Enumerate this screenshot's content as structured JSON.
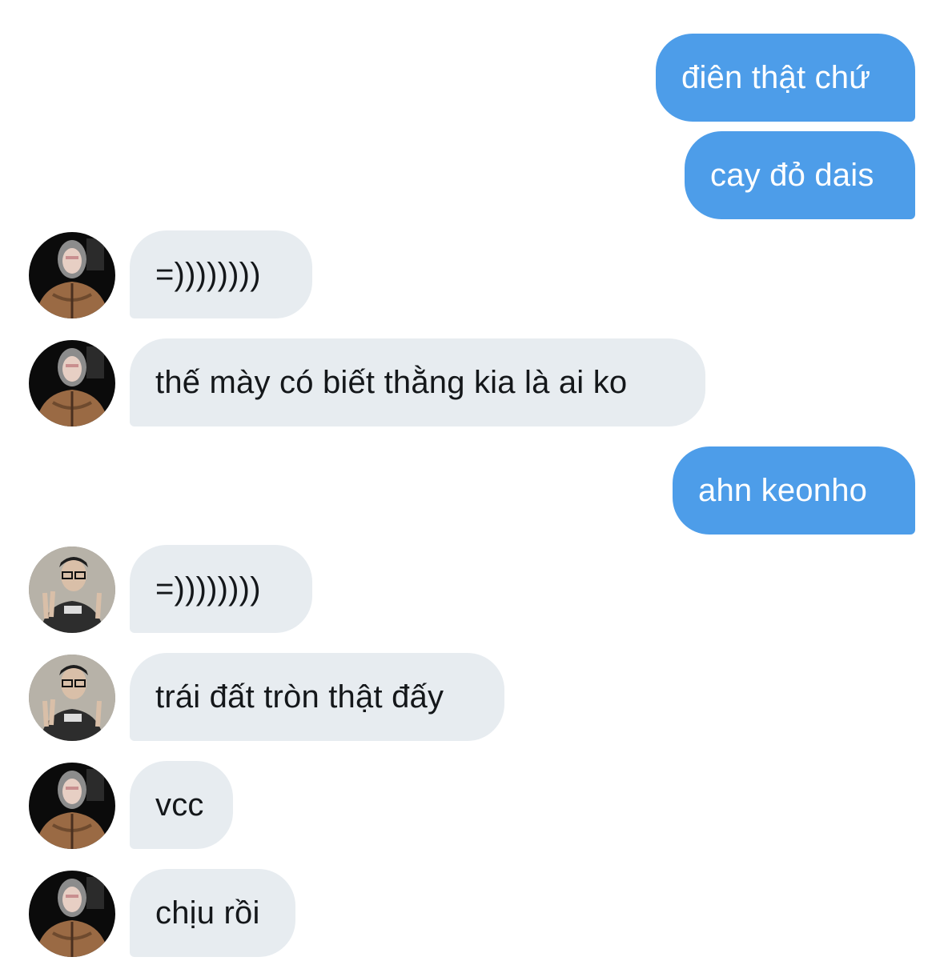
{
  "conversation": {
    "messages": [
      {
        "direction": "outgoing",
        "text": "điên thật chứ"
      },
      {
        "direction": "outgoing",
        "text": "cay đỏ dais"
      },
      {
        "direction": "incoming",
        "sender_avatar": "avatar-hooded",
        "text": "=))))))))"
      },
      {
        "direction": "incoming",
        "sender_avatar": "avatar-hooded",
        "text": "thế mày có biết thằng kia là ai ko"
      },
      {
        "direction": "outgoing",
        "text": "ahn keonho"
      },
      {
        "direction": "incoming",
        "sender_avatar": "avatar-glasses",
        "text": "=))))))))"
      },
      {
        "direction": "incoming",
        "sender_avatar": "avatar-glasses",
        "text": "trái đất tròn thật đấy"
      },
      {
        "direction": "incoming",
        "sender_avatar": "avatar-hooded",
        "text": "vcc"
      },
      {
        "direction": "incoming",
        "sender_avatar": "avatar-hooded",
        "text": "chịu rồi"
      }
    ]
  },
  "colors": {
    "outgoing_bubble": "#4d9de9",
    "incoming_bubble": "#e7ecf0",
    "outgoing_text": "#ffffff",
    "incoming_text": "#14171a",
    "background": "#ffffff"
  }
}
